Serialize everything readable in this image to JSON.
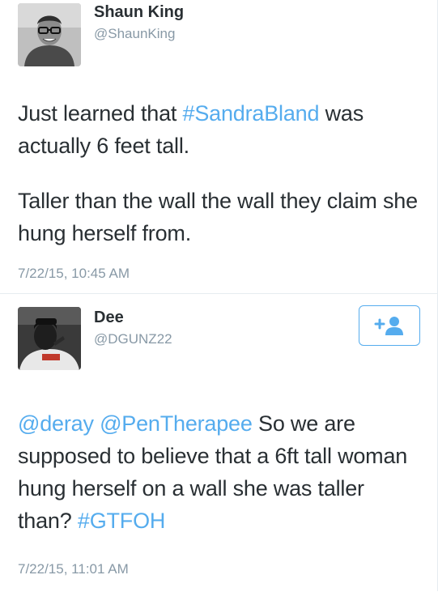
{
  "tweets": [
    {
      "display_name": "Shaun King",
      "username": "@ShaunKing",
      "avatar_icon": "person-with-glasses-avatar",
      "paragraph_1": {
        "text_before": "Just learned that ",
        "hashtag": "#SandraBland",
        "text_after": " was actually 6 feet tall."
      },
      "paragraph_2": "Taller than the wall the wall they claim she hung herself from.",
      "timestamp": "7/22/15, 10:45 AM"
    },
    {
      "display_name": "Dee",
      "username": "@DGUNZ22",
      "avatar_icon": "person-avatar",
      "follow_icon": "add-user-icon",
      "paragraph_1": {
        "mention_1": "@deray",
        "mention_2": "@PenTherapee",
        "text_middle": " So we are supposed to believe that a 6ft tall woman hung herself on a wall she was taller than? ",
        "hashtag": "#GTFOH"
      },
      "timestamp": "7/22/15, 11:01 AM"
    }
  ],
  "colors": {
    "link": "#55acee",
    "text": "#292f33",
    "muted": "#8899a6"
  }
}
